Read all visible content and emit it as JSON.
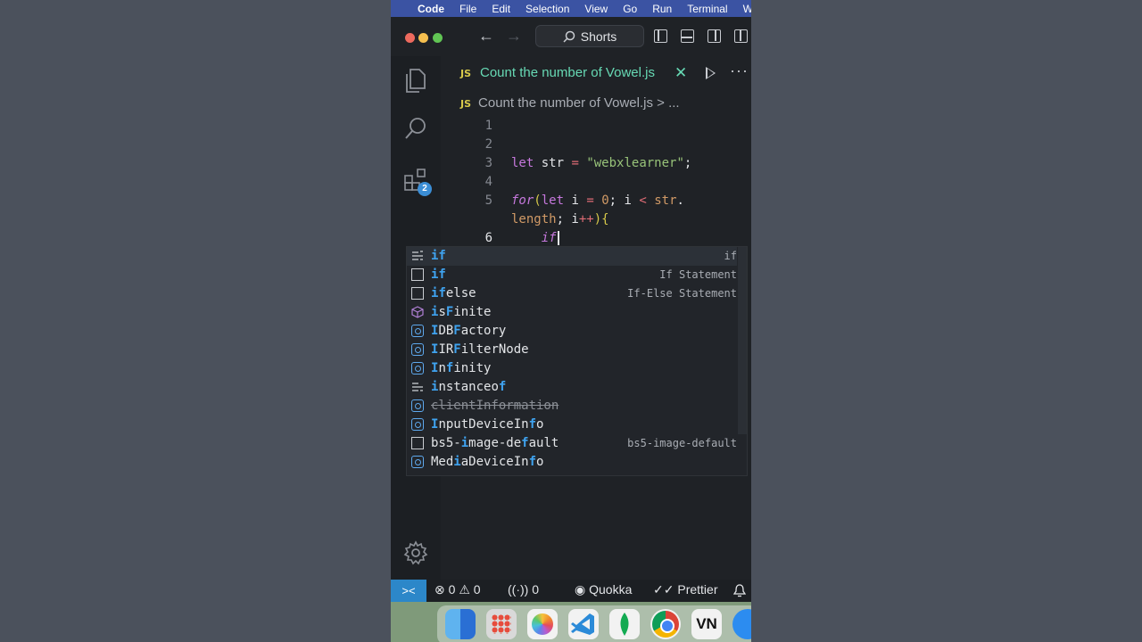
{
  "menubar": {
    "apple": "",
    "app": "Code",
    "items": [
      "File",
      "Edit",
      "Selection",
      "View",
      "Go",
      "Run",
      "Terminal",
      "Win"
    ]
  },
  "titlebar": {
    "search_label": "Shorts"
  },
  "activity": {
    "extensions_badge": "2"
  },
  "tab": {
    "lang": "JS",
    "title": "Count the number of Vowel.js",
    "close": "✕",
    "more": "···"
  },
  "breadcrumb": {
    "lang": "JS",
    "file": "Count the number of Vowel.js",
    "rest": " > ..."
  },
  "code": {
    "line_numbers": [
      "1",
      "2",
      "3",
      "4",
      "5",
      "",
      "6"
    ]
  },
  "suggestions": [
    {
      "label": "if",
      "detail": "if",
      "icon": "snippet-lines-icon"
    },
    {
      "label": "if",
      "detail": "If Statement",
      "icon": "snippet-box-icon"
    },
    {
      "label": "ifelse",
      "detail": "If-Else Statement",
      "icon": "snippet-box-icon"
    },
    {
      "label": "isFinite",
      "detail": "",
      "icon": "method-cube-icon"
    },
    {
      "label": "IDBFactory",
      "detail": "",
      "icon": "variable-icon"
    },
    {
      "label": "IIRFilterNode",
      "detail": "",
      "icon": "variable-icon"
    },
    {
      "label": "Infinity",
      "detail": "",
      "icon": "variable-icon"
    },
    {
      "label": "instanceof",
      "detail": "",
      "icon": "keyword-lines-icon"
    },
    {
      "label": "clientInformation",
      "detail": "",
      "icon": "variable-icon"
    },
    {
      "label": "InputDeviceInfo",
      "detail": "",
      "icon": "variable-icon"
    },
    {
      "label": "bs5-image-default",
      "detail": "bs5-image-default",
      "icon": "snippet-box-icon"
    },
    {
      "label": "MediaDeviceInfo",
      "detail": "",
      "icon": "variable-icon"
    }
  ],
  "statusbar": {
    "remote": "><",
    "errors": "0",
    "warnings": "0",
    "ports": "0",
    "quokka": "Quokka",
    "prettier": "Prettier"
  },
  "colors": {
    "accent": "#2c87c9",
    "tab_active": "#67d9b4",
    "match_highlight": "#3fa3f0"
  }
}
